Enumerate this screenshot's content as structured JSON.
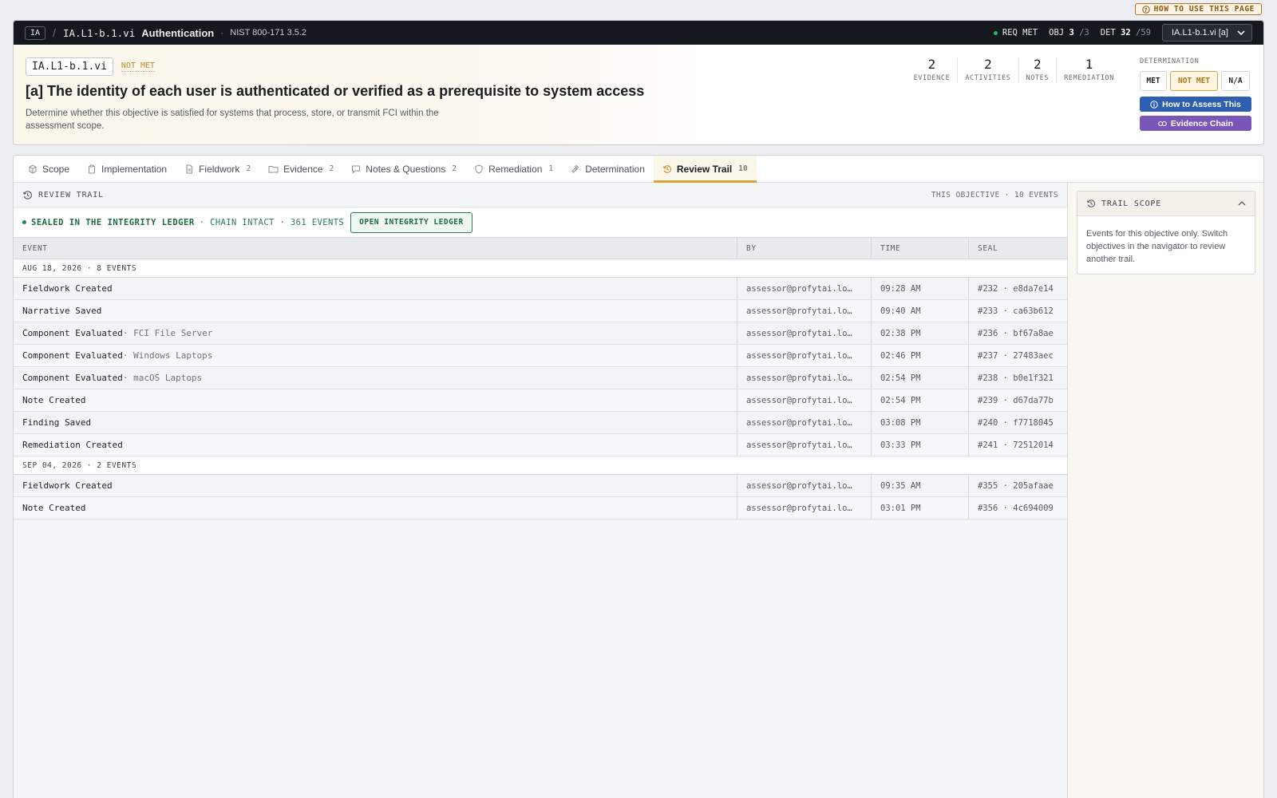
{
  "how_to_use": "HOW TO USE THIS PAGE",
  "topbar": {
    "family": "IA",
    "code": "IA.L1-b.1.vi",
    "name": "Authentication",
    "reference": "NIST 800-171 3.5.2",
    "req_status": "REQ MET",
    "obj_label": "OBJ",
    "obj_value": "3",
    "obj_total": "/3",
    "det_label": "DET",
    "det_value": "32",
    "det_total": "/59",
    "objective_select": "IA.L1-b.1.vi [a]"
  },
  "header": {
    "code": "IA.L1-b.1.vi",
    "status": "NOT MET",
    "title": "[a] The identity of each user is authenticated or verified as a prerequisite to system access",
    "description": "Determine whether this objective is satisfied for systems that process, store, or transmit FCI within the assessment scope.",
    "stats": [
      {
        "value": "2",
        "label": "EVIDENCE"
      },
      {
        "value": "2",
        "label": "ACTIVITIES"
      },
      {
        "value": "2",
        "label": "NOTES"
      },
      {
        "value": "1",
        "label": "REMEDIATION"
      }
    ],
    "determination_label": "DETERMINATION",
    "determination_options": [
      "MET",
      "NOT MET",
      "N/A"
    ],
    "determination_selected": "NOT MET",
    "how_to_assess": "How to Assess This",
    "evidence_chain": "Evidence Chain"
  },
  "tabs": [
    {
      "label": "Scope",
      "count": "",
      "icon": "scope-icon"
    },
    {
      "label": "Implementation",
      "count": "",
      "icon": "clipboard-icon"
    },
    {
      "label": "Fieldwork",
      "count": "2",
      "icon": "document-icon"
    },
    {
      "label": "Evidence",
      "count": "2",
      "icon": "folder-icon"
    },
    {
      "label": "Notes & Questions",
      "count": "2",
      "icon": "chat-icon"
    },
    {
      "label": "Remediation",
      "count": "1",
      "icon": "shield-icon"
    },
    {
      "label": "Determination",
      "count": "",
      "icon": "gavel-icon"
    },
    {
      "label": "Review Trail",
      "count": "10",
      "icon": "history-icon",
      "active": true
    }
  ],
  "review_trail": {
    "title": "REVIEW TRAIL",
    "meta": "THIS OBJECTIVE · 10 EVENTS",
    "sealed": "SEALED IN THE INTEGRITY LEDGER",
    "chain": "· CHAIN INTACT · 361 EVENTS",
    "ledger_button": "OPEN INTEGRITY LEDGER",
    "columns": [
      "EVENT",
      "BY",
      "TIME",
      "SEAL"
    ],
    "groups": [
      {
        "label": "AUG 18, 2026 · 8 EVENTS",
        "rows": [
          {
            "event": "Fieldwork Created",
            "detail": "",
            "by": "assessor@profytai.lo…",
            "time": "09:28 AM",
            "seal": "#232 · e8da7e14"
          },
          {
            "event": "Narrative Saved",
            "detail": "",
            "by": "assessor@profytai.lo…",
            "time": "09:40 AM",
            "seal": "#233 · ca63b612"
          },
          {
            "event": "Component Evaluated",
            "detail": " · FCI File Server",
            "by": "assessor@profytai.lo…",
            "time": "02:38 PM",
            "seal": "#236 · bf67a8ae"
          },
          {
            "event": "Component Evaluated",
            "detail": " · Windows Laptops",
            "by": "assessor@profytai.lo…",
            "time": "02:46 PM",
            "seal": "#237 · 27483aec"
          },
          {
            "event": "Component Evaluated",
            "detail": " · macOS Laptops",
            "by": "assessor@profytai.lo…",
            "time": "02:54 PM",
            "seal": "#238 · b0e1f321"
          },
          {
            "event": "Note Created",
            "detail": "",
            "by": "assessor@profytai.lo…",
            "time": "02:54 PM",
            "seal": "#239 · d67da77b"
          },
          {
            "event": "Finding Saved",
            "detail": "",
            "by": "assessor@profytai.lo…",
            "time": "03:08 PM",
            "seal": "#240 · f7718045"
          },
          {
            "event": "Remediation Created",
            "detail": "",
            "by": "assessor@profytai.lo…",
            "time": "03:33 PM",
            "seal": "#241 · 72512014"
          }
        ]
      },
      {
        "label": "SEP 04, 2026 · 2 EVENTS",
        "rows": [
          {
            "event": "Fieldwork Created",
            "detail": "",
            "by": "assessor@profytai.lo…",
            "time": "09:35 AM",
            "seal": "#355 · 205afaae"
          },
          {
            "event": "Note Created",
            "detail": "",
            "by": "assessor@profytai.lo…",
            "time": "03:01 PM",
            "seal": "#356 · 4c694009"
          }
        ]
      }
    ]
  },
  "trail_scope": {
    "title": "TRAIL SCOPE",
    "body": "Events for this objective only. Switch objectives in the navigator to review another trail."
  }
}
